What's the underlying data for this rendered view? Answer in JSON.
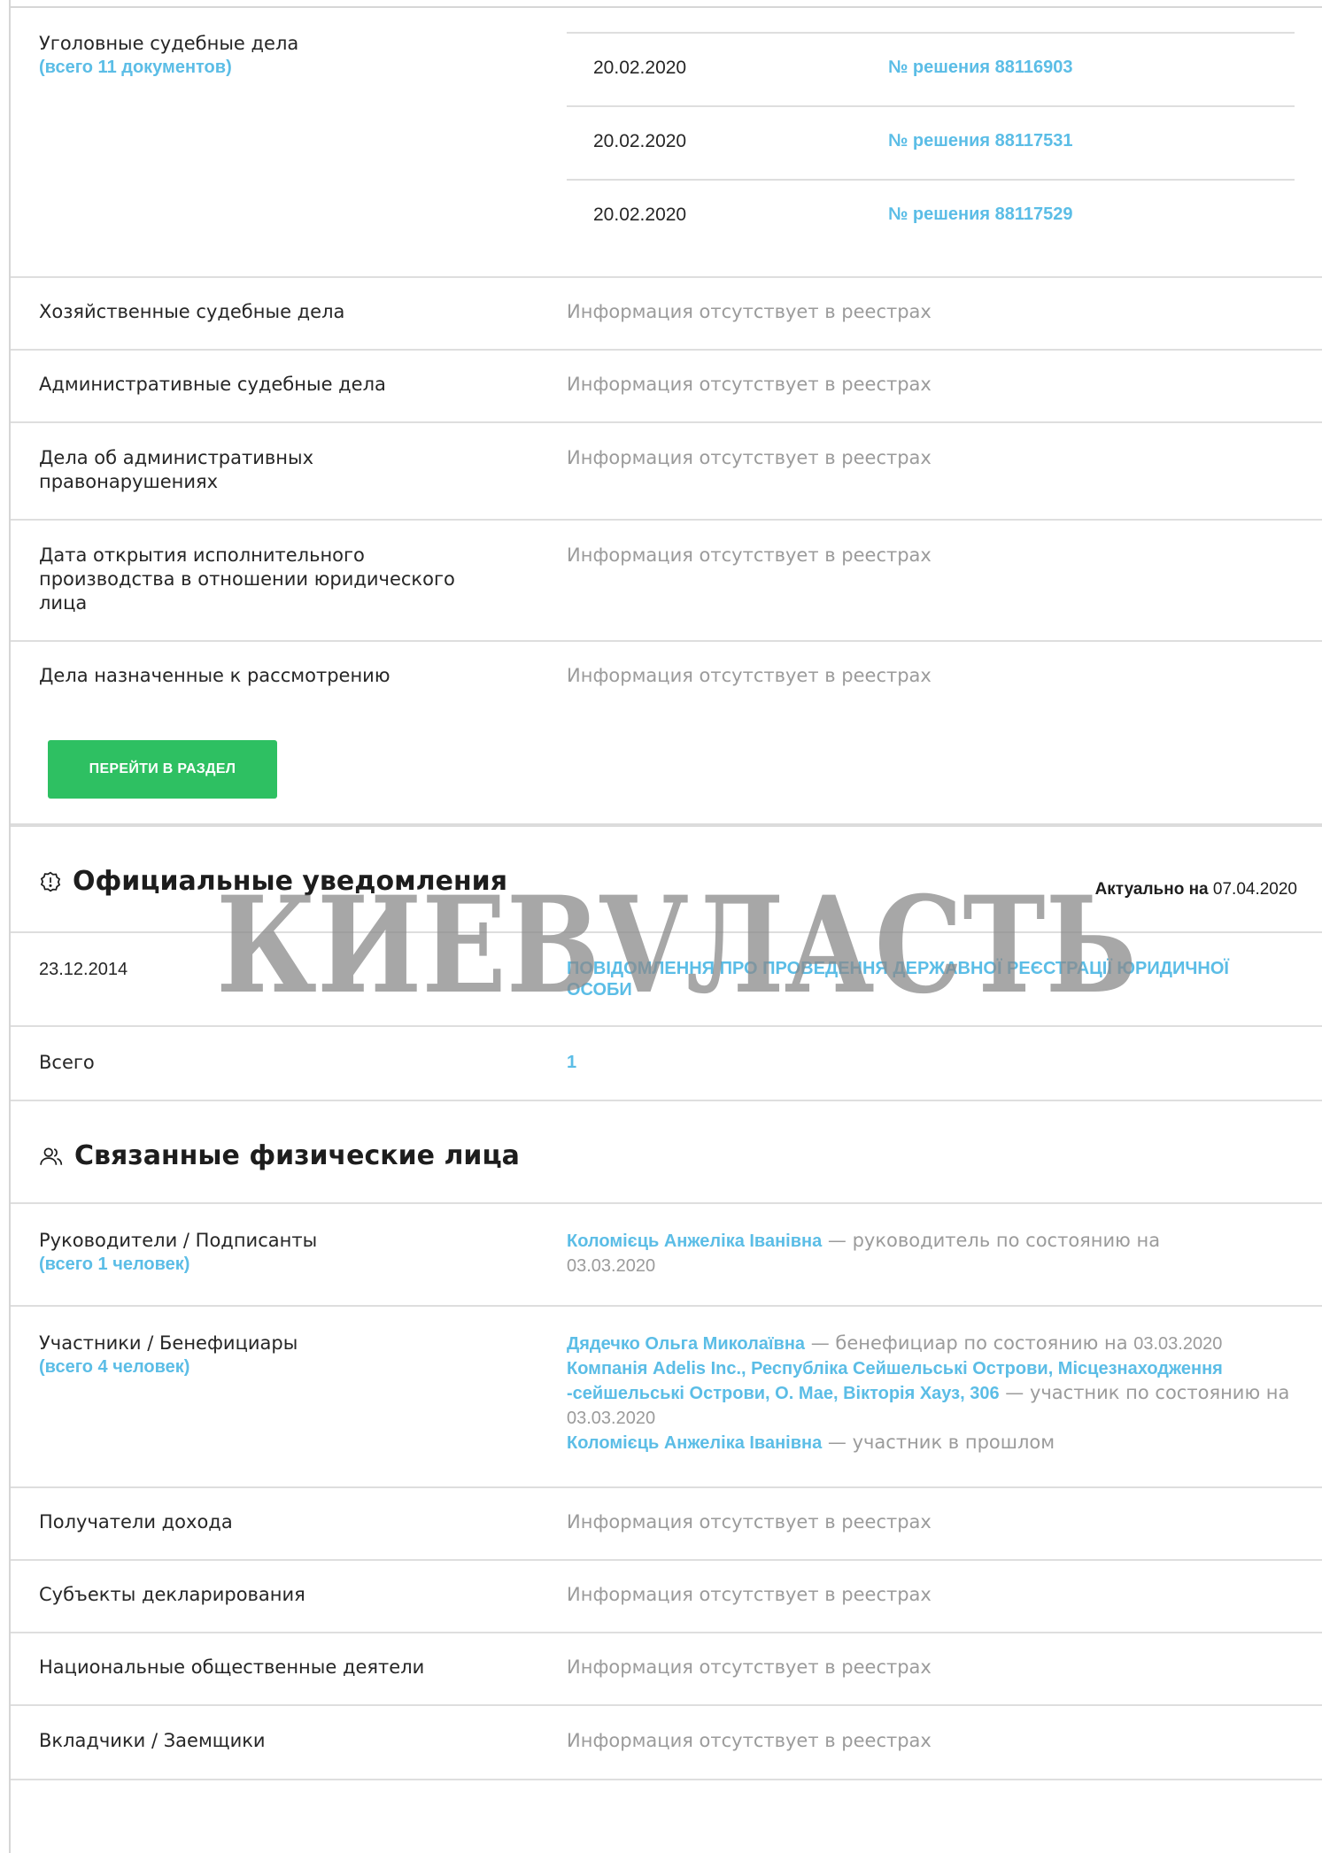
{
  "court": {
    "criminal": {
      "label": "Уголовные судебные дела",
      "count": "(всего 11 документов)",
      "decisions": [
        {
          "date": "20.02.2020",
          "link": "№ решения 88116903"
        },
        {
          "date": "20.02.2020",
          "link": "№ решения 88117531"
        },
        {
          "date": "20.02.2020",
          "link": "№ решения 88117529"
        }
      ]
    },
    "rows": [
      {
        "label": "Хозяйственные судебные дела",
        "value": "Информация отсутствует в реестрах"
      },
      {
        "label": "Административные судебные дела",
        "value": "Информация отсутствует в реестрах"
      },
      {
        "label": "Дела об административных правонарушениях",
        "value": "Информация отсутствует в реестрах"
      },
      {
        "label": "Дата открытия исполнительного производства в отношении юридического лица",
        "value": "Информация отсутствует в реестрах"
      },
      {
        "label": "Дела назначенные к рассмотрению",
        "value": "Информация отсутствует в реестрах"
      }
    ],
    "button": "ПЕРЕЙТИ В РАЗДЕЛ"
  },
  "notices": {
    "title": "Официальные уведомления",
    "actual_label": "Актуально на",
    "actual_date": "07.04.2020",
    "item": {
      "date": "23.12.2014",
      "link": "ПОВІДОМЛЕННЯ ПРО ПРОВЕДЕННЯ ДЕРЖАВНОЇ РЕЄСТРАЦІЇ ЮРИДИЧНОЇ ОСОБИ"
    },
    "total_label": "Всего",
    "total_value": "1"
  },
  "watermark": "КИЕВVЛАСТЬ",
  "persons": {
    "title": "Связанные физические лица",
    "heads": {
      "label": "Руководители / Подписанты",
      "count": "(всего 1 человек)",
      "name": "Коломієць Анжеліка Іванівна",
      "role": " — руководитель по состоянию на ",
      "date": "03.03.2020"
    },
    "participants": {
      "label": "Участники / Бенефициары",
      "count": "(всего 4 человек)",
      "p1_name": "Дядечко Ольга Миколаївна",
      "p1_role": " — бенефициар по состоянию на ",
      "p1_date": "03.03.2020",
      "p2_name": "Компанія Adelis Inc., Республіка Сейшельські Острови, Місцезнаходження -сейшельські Острови, О. Мае, Вікторія Хауз, 306",
      "p2_role": " — участник по состоянию на ",
      "p2_date": "03.03.2020",
      "p3_name": "Коломієць Анжеліка Іванівна",
      "p3_role": " — участник в прошлом"
    },
    "rows": [
      {
        "label": "Получатели дохода",
        "value": "Информация отсутствует в реестрах"
      },
      {
        "label": "Субъекты декларирования",
        "value": "Информация отсутствует в реестрах"
      },
      {
        "label": "Национальные общественные деятели",
        "value": "Информация отсутствует в реестрах"
      },
      {
        "label": "Вкладчики / Заемщики",
        "value": "Информация отсутствует в реестрах"
      }
    ]
  }
}
